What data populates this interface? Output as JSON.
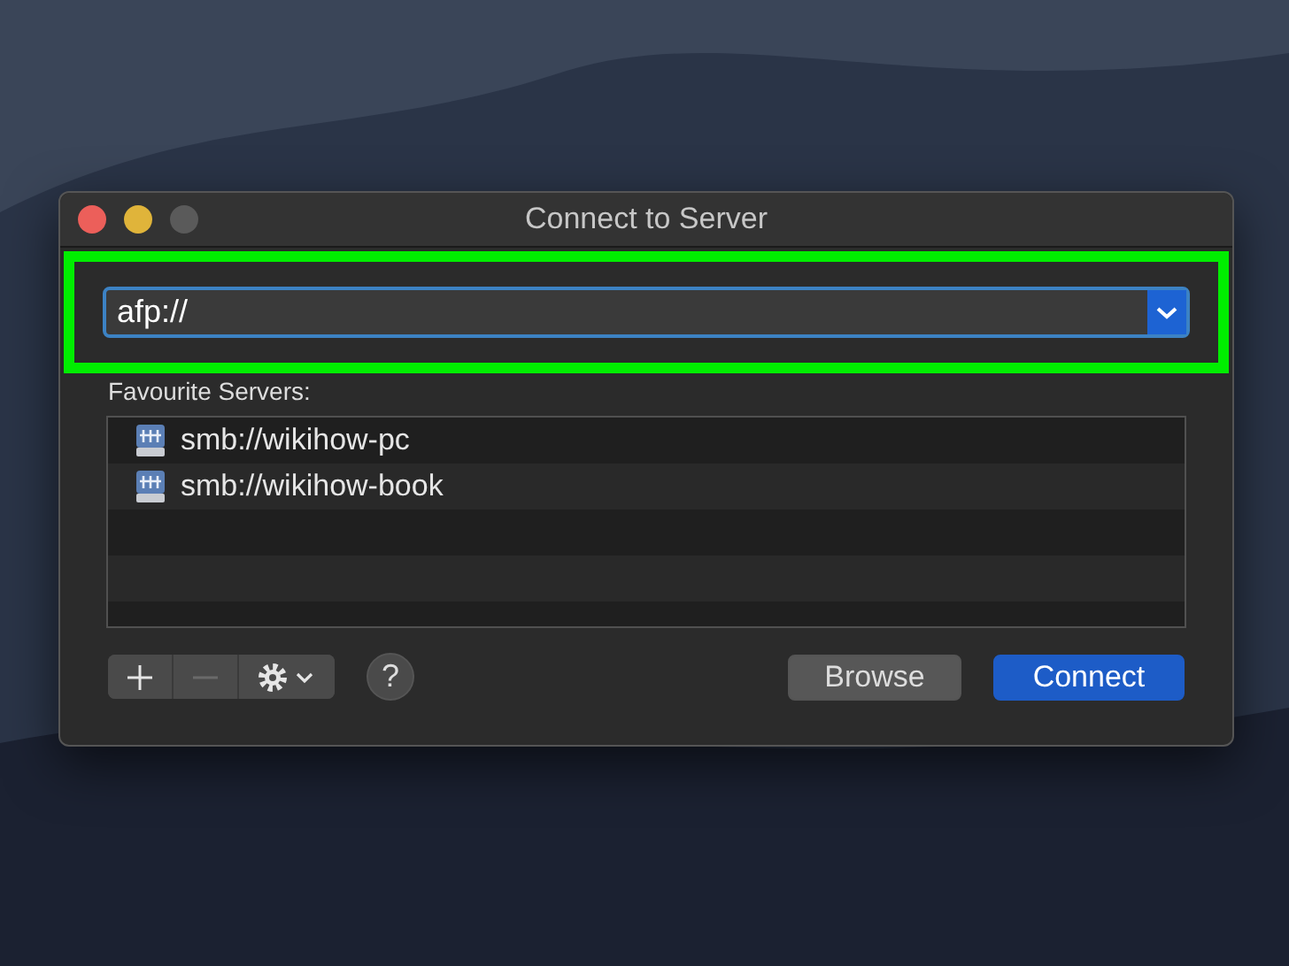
{
  "window": {
    "title": "Connect to Server"
  },
  "address_field": {
    "value": "afp://",
    "highlighted": true
  },
  "favourites": {
    "label": "Favourite Servers:",
    "items": [
      {
        "name": "smb://wikihow-pc"
      },
      {
        "name": "smb://wikihow-book"
      }
    ]
  },
  "toolbar": [
    {
      "kind": "add",
      "disabled": false
    },
    {
      "kind": "remove",
      "disabled": true
    },
    {
      "kind": "action",
      "disabled": false
    }
  ],
  "help": "?",
  "buttons": [
    {
      "label": "Browse",
      "kind": "secondary"
    },
    {
      "label": "Connect",
      "kind": "primary"
    }
  ]
}
